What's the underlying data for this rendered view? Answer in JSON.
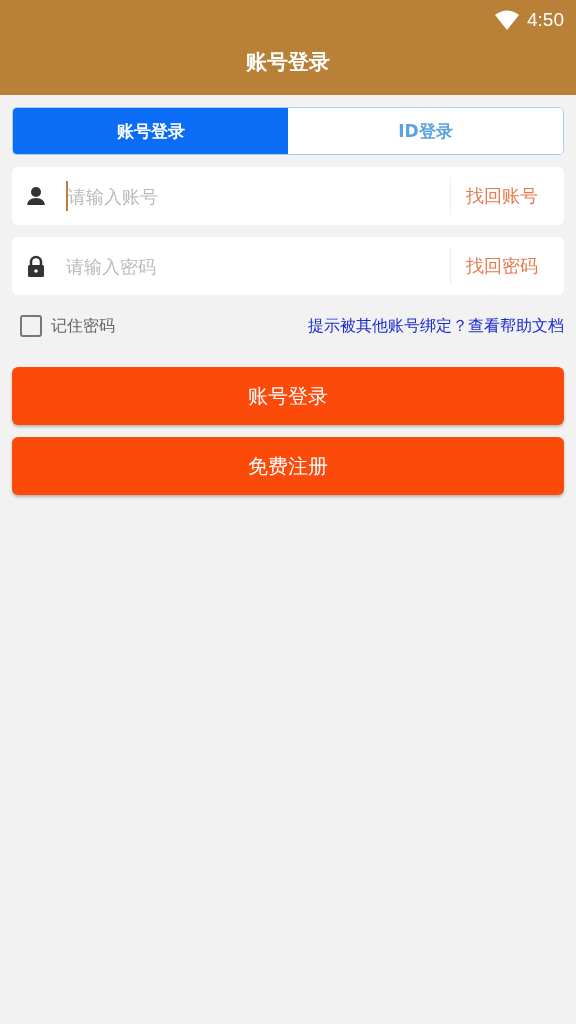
{
  "status_bar": {
    "time": "4:50"
  },
  "toolbar": {
    "title": "账号登录"
  },
  "tabs": [
    {
      "label": "账号登录",
      "selected": true
    },
    {
      "label": "ID登录",
      "selected": false
    }
  ],
  "fields": [
    {
      "kind": "user",
      "placeholder": "请输入账号",
      "focused": true,
      "action": "找回账号"
    },
    {
      "kind": "lock",
      "placeholder": "请输入密码",
      "focused": false,
      "action": "找回密码"
    }
  ],
  "remember": {
    "label": "记住密码",
    "checked": false
  },
  "help_link": "提示被其他账号绑定？查看帮助文档",
  "buttons": [
    "账号登录",
    "免费注册"
  ]
}
